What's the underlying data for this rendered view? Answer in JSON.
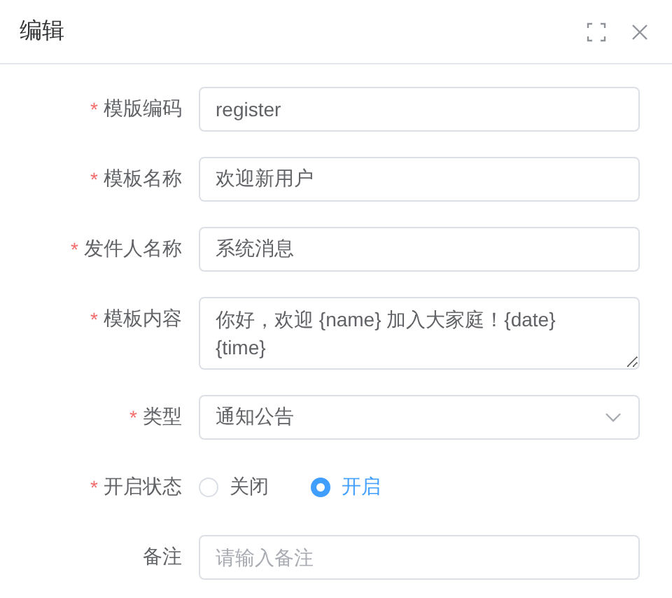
{
  "dialog": {
    "title": "编辑"
  },
  "required_mark": "*",
  "fields": [
    {
      "kind": "input",
      "label": "模版编码",
      "required": true,
      "value": "register"
    },
    {
      "kind": "input",
      "label": "模板名称",
      "required": true,
      "value": "欢迎新用户"
    },
    {
      "kind": "input",
      "label": "发件人名称",
      "required": true,
      "value": "系统消息"
    },
    {
      "kind": "textarea",
      "label": "模板内容",
      "required": true,
      "value": "你好，欢迎 {name} 加入大家庭！{date} {time}"
    },
    {
      "kind": "select",
      "label": "类型",
      "required": true,
      "value": "通知公告"
    },
    {
      "kind": "radio",
      "label": "开启状态",
      "required": true,
      "options": [
        {
          "label": "关闭",
          "selected": false
        },
        {
          "label": "开启",
          "selected": true
        }
      ]
    },
    {
      "kind": "input",
      "label": "备注",
      "required": false,
      "placeholder": "请输入备注"
    }
  ]
}
